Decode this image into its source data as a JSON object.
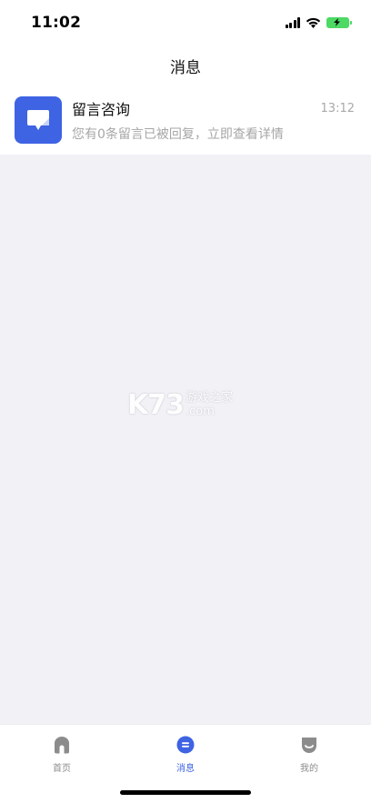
{
  "status_bar": {
    "time": "11:02"
  },
  "nav": {
    "title": "消息"
  },
  "messages": [
    {
      "title": "留言咨询",
      "time": "13:12",
      "description": "您有0条留言已被回复，立即查看详情",
      "icon": "message-bubble-icon",
      "icon_color": "#3e63e3"
    }
  ],
  "watermark": {
    "logo": "K73",
    "line1": "游戏之家",
    "line2": ".com"
  },
  "tab_bar": {
    "items": [
      {
        "label": "首页",
        "icon": "home-icon",
        "active": false
      },
      {
        "label": "消息",
        "icon": "message-icon",
        "active": true
      },
      {
        "label": "我的",
        "icon": "profile-icon",
        "active": false
      }
    ],
    "active_color": "#3e63e3",
    "inactive_color": "#8c8c8c"
  }
}
